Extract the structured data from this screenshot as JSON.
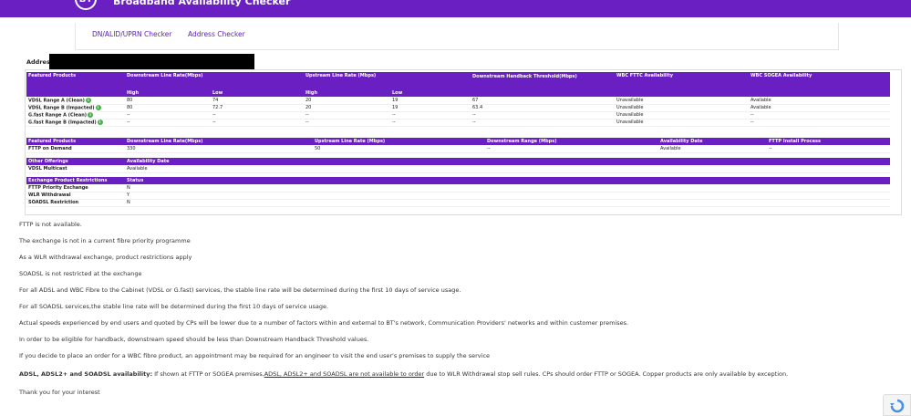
{
  "header": {
    "logo": "BT",
    "title": "Broadband Availability Checker"
  },
  "nav": {
    "tab1": "DN/ALID/UPRN Checker",
    "tab2": "Address Checker"
  },
  "address": {
    "label": "Address"
  },
  "table1": {
    "headers": [
      "Featured Products",
      "Downstream Line Rate(Mbps)",
      "Upstream Line Rate (Mbps)",
      "Downstream Handback Threshold(Mbps)",
      "WBC FTTC Availability",
      "WBC SOGEA Availability"
    ],
    "sub": [
      "High",
      "Low",
      "High",
      "Low"
    ],
    "rows": [
      {
        "name": "VDSL Range A (Clean)",
        "dh": "80",
        "dl": "74",
        "uh": "20",
        "ul": "19",
        "thr": "67",
        "fttc": "Unavailable",
        "sogea": "Available"
      },
      {
        "name": "VDSL Range B (Impacted)",
        "dh": "80",
        "dl": "72.7",
        "uh": "20",
        "ul": "19",
        "thr": "63.4",
        "fttc": "Unavailable",
        "sogea": "Available"
      },
      {
        "name": "G.fast Range A (Clean)",
        "dh": "--",
        "dl": "--",
        "uh": "--",
        "ul": "--",
        "thr": "--",
        "fttc": "Unavailable",
        "sogea": "--"
      },
      {
        "name": "G.fast Range B (Impacted)",
        "dh": "--",
        "dl": "--",
        "uh": "--",
        "ul": "--",
        "thr": "--",
        "fttc": "Unavailable",
        "sogea": "--"
      }
    ]
  },
  "table2": {
    "headers": [
      "Featured Products",
      "Downstream Line Rate(Mbps)",
      "Upstream Line Rate (Mbps)",
      "Downstream Range (Mbps)",
      "Availability Date",
      "FTTP Install Process"
    ],
    "rows": [
      {
        "name": "FTTP on Demand",
        "down": "330",
        "up": "50",
        "range": "--",
        "date": "Available",
        "install": "--"
      }
    ]
  },
  "table3": {
    "headers": [
      "Other Offerings",
      "Availability Date"
    ],
    "rows": [
      {
        "name": "VDSL Multicast",
        "value": "Available"
      }
    ]
  },
  "table4": {
    "headers": [
      "Exchange Product Restrictions",
      "Status"
    ],
    "rows": [
      {
        "name": "FTTP Priority Exchange",
        "value": "N"
      },
      {
        "name": "WLR Withdrawal",
        "value": "Y"
      },
      {
        "name": "SOADSL Restriction",
        "value": "N"
      }
    ]
  },
  "messages": {
    "m1": "FTTP is not available.",
    "m2": "The exchange is not in a current fibre priority programme",
    "m3": "As a WLR withdrawal exchange, product restrictions apply",
    "m4": "SOADSL is not restricted at the exchange",
    "m5": "For all ADSL and WBC Fibre to the Cabinet (VDSL or G.fast) services, the stable line rate will be determined during the first 10 days of service usage.",
    "m6": "For all SOADSL services,the stable line rate will be determined during the first 10 days of service usage.",
    "m7": "Actual speeds experienced by end users and quoted by CPs will be lower due to a number of factors within and external to BT's network, Communication Providers' networks and within customer premises.",
    "m8": "In order to be eligible for handback, downstream speed should be less than Downstream Handback Threshold values.",
    "m9": "If you decide to place an order for a WBC fibre product, an appointment may be required for an engineer to visit the end user's premises to supply the service",
    "m10_bold": "ADSL, ADSL2+ and SOADSL availability:",
    "m10_a": " If shown at FTTP or SOGEA premises,",
    "m10_u": "ADSL, ADSL2+ and SOADSL are not available to order",
    "m10_b": " due to WLR Withdrawal stop sell rules. CPs should order FTTP or SOGEA. Copper products are only available by exception.",
    "m11": "Thank you for your interest"
  },
  "colors": {
    "brand": "#6a1fc2",
    "info": "#4caf50"
  },
  "icons": {
    "info": "info-icon",
    "recaptcha": "recaptcha-icon"
  }
}
